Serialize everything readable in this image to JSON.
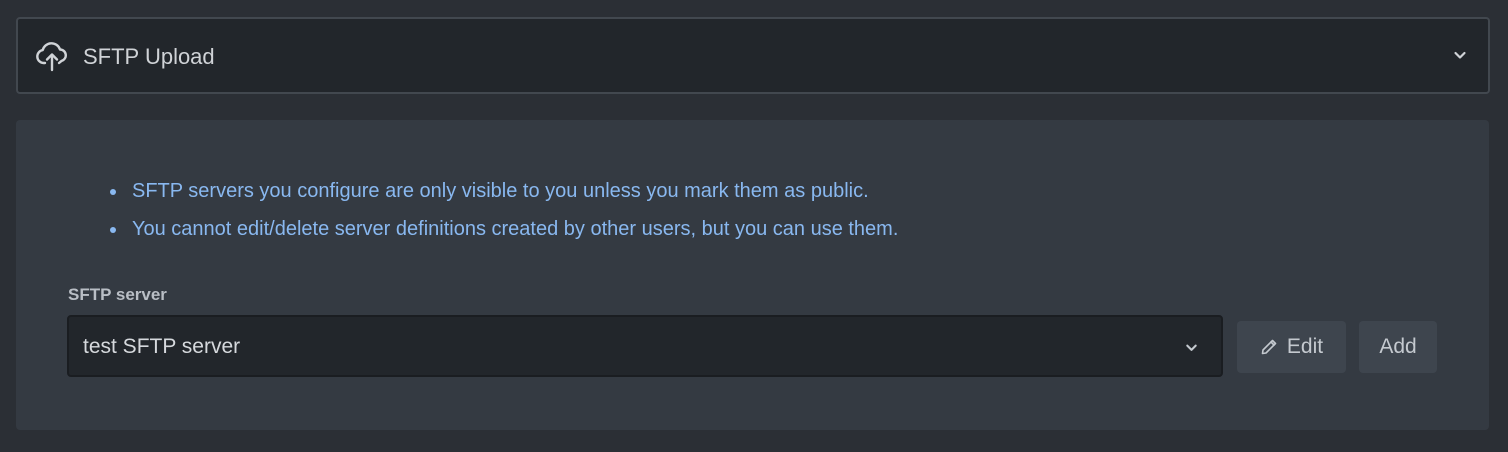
{
  "accordion": {
    "title": "SFTP Upload",
    "icon": "cloud-upload-icon",
    "toggle_icon": "chevron-down-icon"
  },
  "notes": [
    "SFTP servers you configure are only visible to you unless you mark them as public.",
    "You cannot edit/delete server definitions created by other users, but you can use them."
  ],
  "server_field": {
    "label": "SFTP server",
    "selected": "test SFTP server"
  },
  "buttons": {
    "edit_label": "Edit",
    "add_label": "Add"
  },
  "colors": {
    "background": "#2b2f35",
    "header_bg": "#22262b",
    "panel_bg": "#343a42",
    "note_text": "#89b8f0"
  }
}
